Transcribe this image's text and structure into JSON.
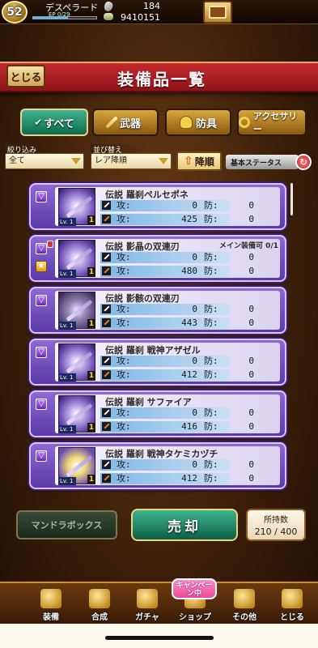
{
  "status_bar": {
    "level": "52",
    "player_name": "デスペラード",
    "exp_label": "EP 0/29",
    "exp_fraction": 0.55,
    "stones": "184",
    "gold": "9410151"
  },
  "header": {
    "close_label": "とじる",
    "title": "装備品一覧"
  },
  "tabs": {
    "all": "すべて",
    "weapon": "武器",
    "armor": "防具",
    "accessory": "アクセサリー"
  },
  "filters": {
    "filter_label": "絞り込み",
    "filter_value": "全て",
    "sort_label": "並び替え",
    "sort_value": "レア降順",
    "order_label": "降順",
    "basic_status_label": "基本ステータス"
  },
  "stat_labels": {
    "atk": "攻:",
    "def": "防:"
  },
  "items": [
    {
      "name": "伝説 羅刹ペルセポネ",
      "flag": "",
      "lv": "Lv. 1",
      "plus": "1",
      "atk1": "0",
      "def1": "0",
      "atk2": "425",
      "def2": "0"
    },
    {
      "name": "伝説 影晶の双連刃",
      "flag": "メイン装備可 0/1",
      "lv": "Lv. 1",
      "plus": "1",
      "atk1": "0",
      "def1": "0",
      "atk2": "480",
      "def2": "0"
    },
    {
      "name": "伝説 影骸の双連刃",
      "flag": "",
      "lv": "Lv. 1",
      "plus": "1",
      "atk1": "0",
      "def1": "0",
      "atk2": "443",
      "def2": "0"
    },
    {
      "name": "伝説 羅刹 戦神アザゼル",
      "flag": "",
      "lv": "Lv. 1",
      "plus": "1",
      "atk1": "0",
      "def1": "0",
      "atk2": "412",
      "def2": "0"
    },
    {
      "name": "伝説 羅刹 サファイア",
      "flag": "",
      "lv": "Lv. 1",
      "plus": "1",
      "atk1": "0",
      "def1": "0",
      "atk2": "416",
      "def2": "0"
    },
    {
      "name": "伝説 羅刹 戦神タケミカヅチ",
      "flag": "",
      "lv": "Lv. 1",
      "plus": "1",
      "atk1": "0",
      "def1": "0",
      "atk2": "412",
      "def2": "0"
    }
  ],
  "actions": {
    "mandora_label": "マンドラボックス",
    "sell_label": "売却",
    "count_label": "所持数",
    "count_value": "210 / 400"
  },
  "nav": {
    "equip": "装備",
    "combine": "合成",
    "gacha": "ガチャ",
    "shop": "ショップ",
    "other": "その他",
    "close": "とじる",
    "campaign_badge": "キャンペーン中"
  }
}
